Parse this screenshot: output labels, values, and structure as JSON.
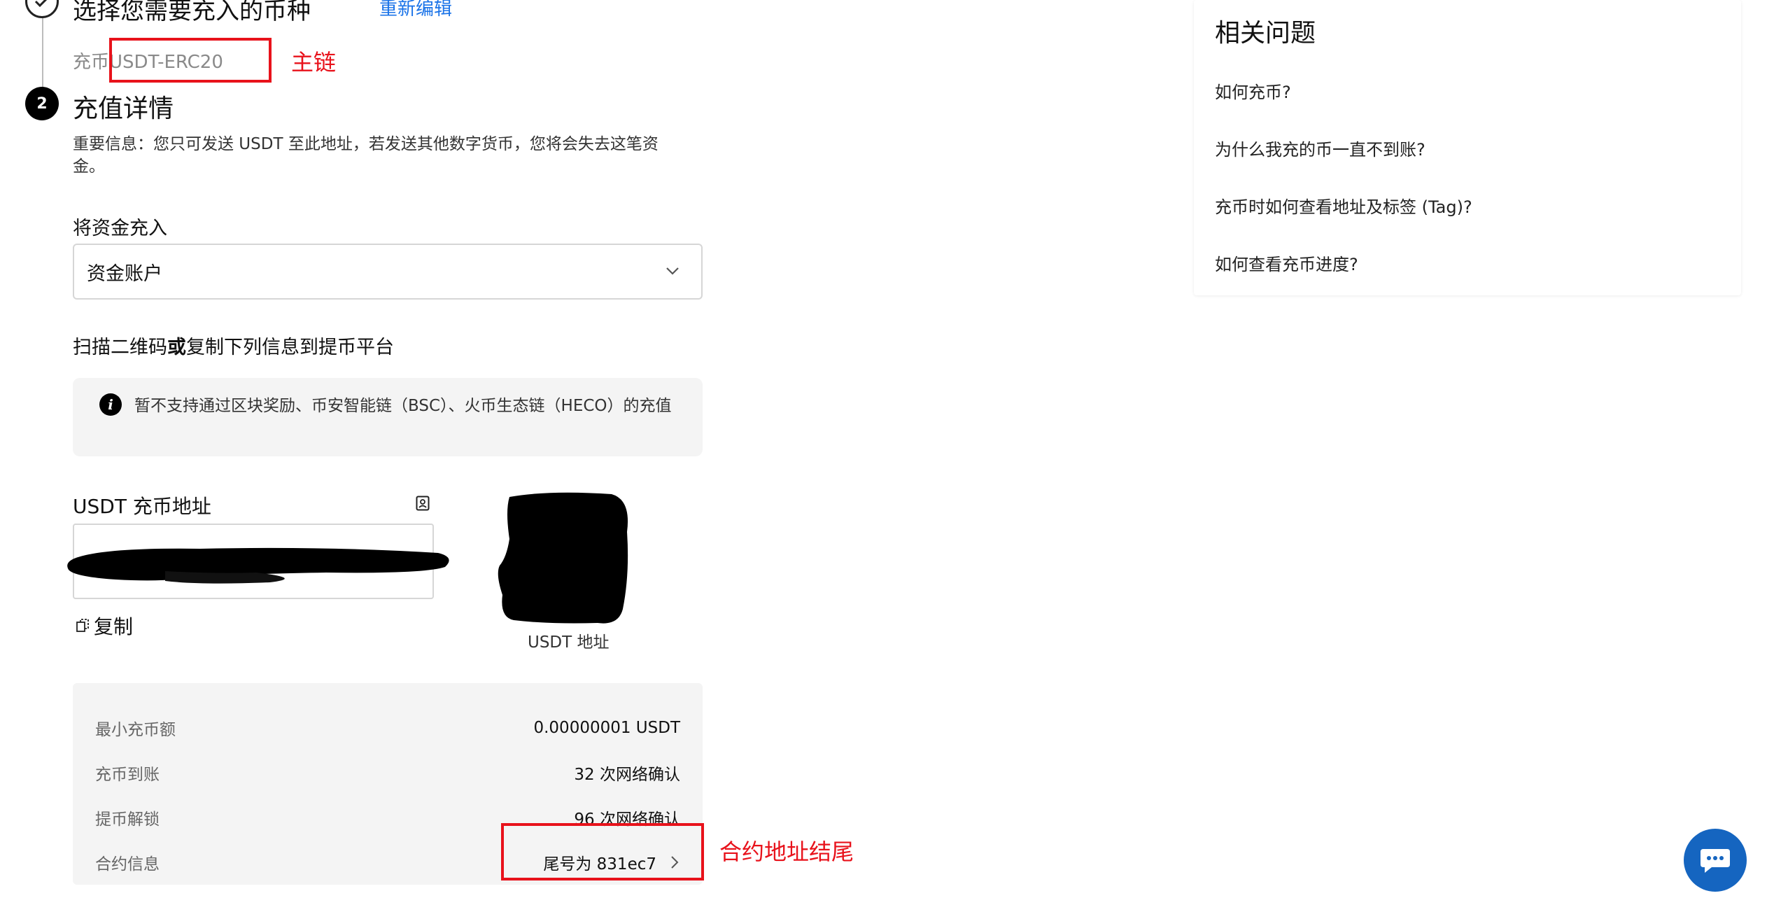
{
  "step1": {
    "number": "✓",
    "title": "选择您需要充入的币种",
    "reedit_label": "重新编辑",
    "coin_label": "充币",
    "coin_value": "USDT-ERC20",
    "annotation_main_chain": "主链"
  },
  "step2": {
    "number": "2",
    "title": "充值详情",
    "notice": "重要信息：您只可发送 USDT 至此地址，若发送其他数字货币，您将会失去这笔资金。",
    "fund_label": "将资金充入",
    "fund_selected": "资金账户",
    "scan_prefix": "扫描二维码",
    "scan_or": "或",
    "scan_suffix": "复制下列信息到提币平台",
    "info_text": "暂不支持通过区块奖励、币安智能链（BSC）、火币生态链（HECO）的充值",
    "address_label": "USDT 充币地址",
    "copy_label": "复制",
    "qr_caption": "USDT 地址"
  },
  "details": {
    "rows": [
      {
        "key": "最小充币额",
        "value": "0.00000001 USDT"
      },
      {
        "key": "充币到账",
        "value": "32 次网络确认"
      },
      {
        "key": "提币解锁",
        "value": "96 次网络确认"
      },
      {
        "key": "合约信息",
        "value": "尾号为 831ec7"
      }
    ],
    "annotation_contract": "合约地址结尾"
  },
  "faq": {
    "title": "相关问题",
    "items": [
      "如何充币?",
      "为什么我充的币一直不到账?",
      "充币时如何查看地址及标签 (Tag)?",
      "如何查看充币进度?"
    ]
  },
  "colors": {
    "annotation_red": "#e8121b",
    "link_blue": "#1a73e8",
    "chat_blue": "#1565c0"
  },
  "icons": [
    "check-icon",
    "info-icon",
    "chevron-down-icon",
    "contact-card-icon",
    "copy-icon",
    "chevron-right-icon",
    "chat-icon"
  ]
}
